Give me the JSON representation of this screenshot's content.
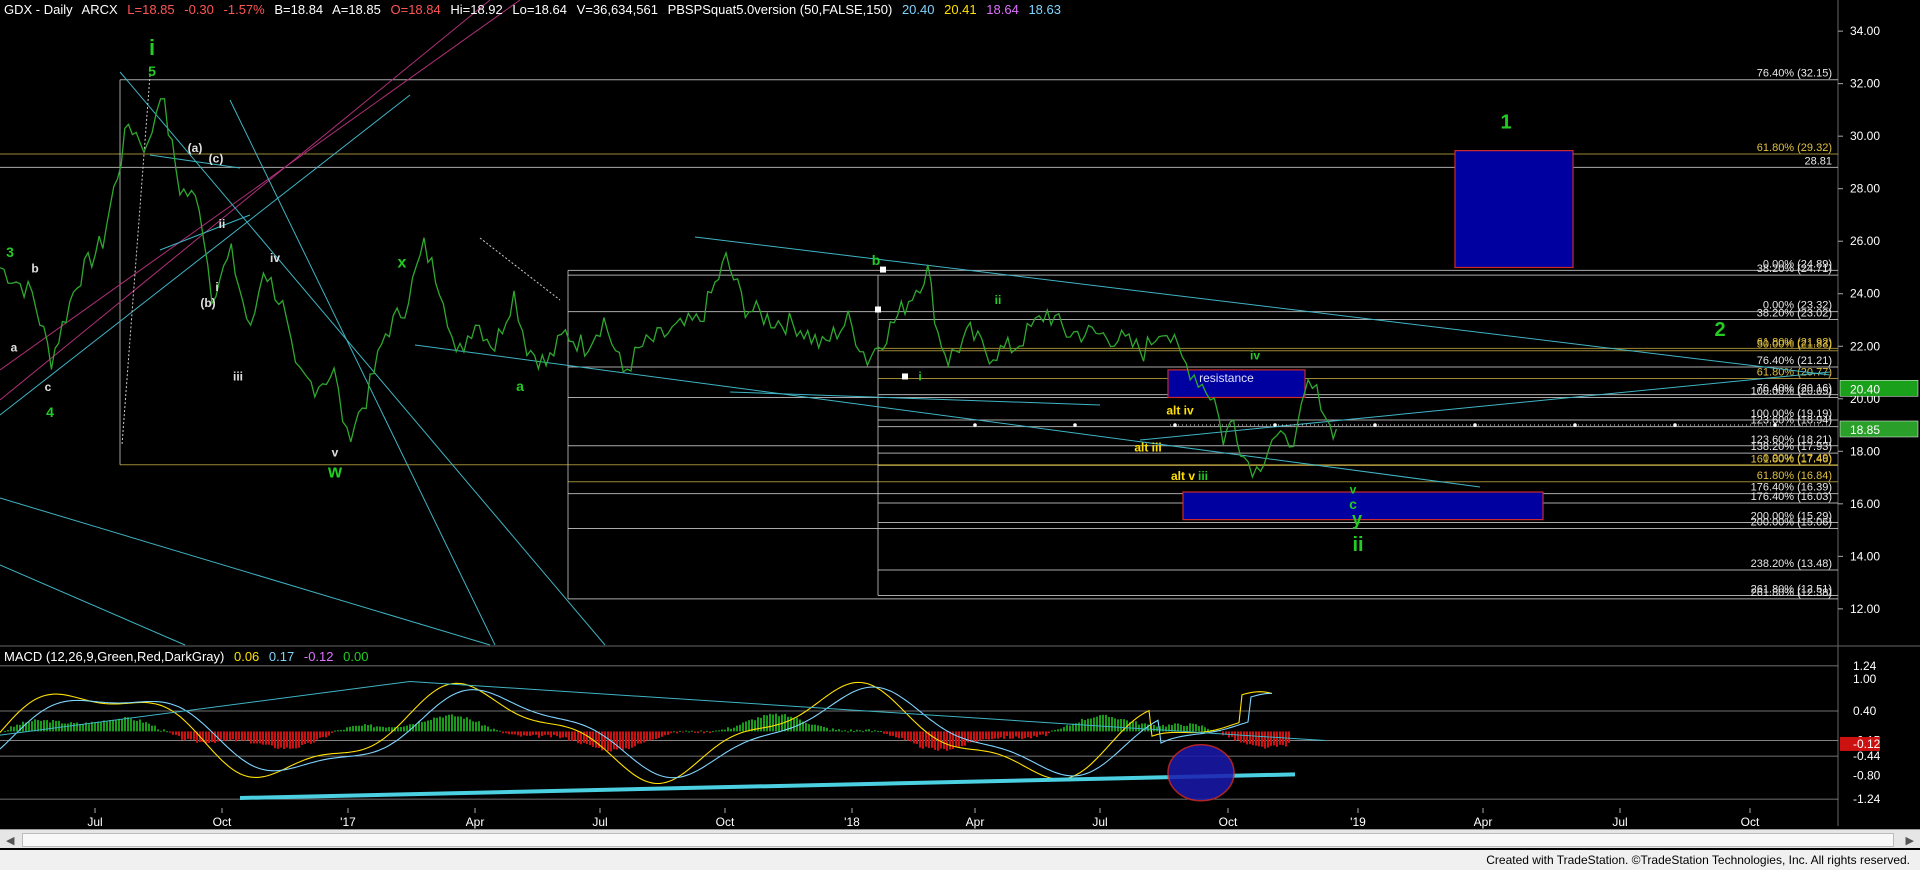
{
  "header": {
    "symbol": "GDX - Daily",
    "exchange": "ARCX",
    "last": "L=18.85",
    "change": "-0.30",
    "change_pct": "-1.57%",
    "bid": "B=18.84",
    "ask": "A=18.85",
    "open": "O=18.84",
    "high": "Hi=18.92",
    "low": "Lo=18.64",
    "volume": "V=36,634,561",
    "indicator": "PBSPSquat5.0version (50,FALSE,150)",
    "ind_v1": "20.40",
    "ind_v2": "20.41",
    "ind_v3": "18.64",
    "ind_v4": "18.63"
  },
  "macd_header": {
    "label": "MACD (12,26,9,Green,Red,DarkGray)",
    "v1": "0.06",
    "v2": "0.17",
    "v3": "-0.12",
    "v4": "0.00"
  },
  "footer": {
    "text": "Created with TradeStation. ©TradeStation Technologies, Inc. All rights reserved."
  },
  "colors": {
    "up": "#1a9a1a",
    "down": "#cc1111",
    "price": "#2ea82e",
    "wave_green": "#22cc22",
    "wave_white": "#e0e0e0",
    "wave_yellow": "#ffe000",
    "channel": "#3fb4c4",
    "magenta": "#b0307a",
    "box_fill": "#0000a0",
    "box_border": "#cc2a2a",
    "fib_line": "#c8c8c8"
  },
  "chart_data": {
    "type": "line",
    "title": "GDX - Daily ARCX",
    "price_axis": {
      "ylim": [
        11.5,
        34.5
      ],
      "ticks": [
        12,
        14,
        16,
        18,
        20,
        22,
        24,
        26,
        28,
        30,
        32,
        34
      ]
    },
    "x_ticks": [
      "Jul",
      "Oct",
      "'17",
      "Apr",
      "Jul",
      "Oct",
      "'18",
      "Apr",
      "Jul",
      "Oct",
      "'19",
      "Apr",
      "Jul",
      "Oct"
    ],
    "last_price_tags": [
      {
        "label": "20.40",
        "value": 20.4
      },
      {
        "label": "18.85",
        "value": 18.85
      }
    ],
    "price_series": [
      [
        0,
        25.0
      ],
      [
        25,
        24.0
      ],
      [
        40,
        21.5
      ],
      [
        60,
        24.5
      ],
      [
        80,
        26.0
      ],
      [
        100,
        30.5
      ],
      [
        115,
        29.5
      ],
      [
        125,
        31.8
      ],
      [
        140,
        28.0
      ],
      [
        155,
        27.5
      ],
      [
        165,
        24.0
      ],
      [
        180,
        25.5
      ],
      [
        195,
        22.5
      ],
      [
        205,
        25.0
      ],
      [
        220,
        23.5
      ],
      [
        230,
        21.0
      ],
      [
        245,
        20.5
      ],
      [
        260,
        21.0
      ],
      [
        270,
        18.5
      ],
      [
        285,
        20.0
      ],
      [
        300,
        22.5
      ],
      [
        315,
        23.5
      ],
      [
        330,
        25.8
      ],
      [
        345,
        24.0
      ],
      [
        355,
        21.5
      ],
      [
        370,
        23.0
      ],
      [
        385,
        22.0
      ],
      [
        400,
        24.0
      ],
      [
        410,
        22.0
      ],
      [
        425,
        21.3
      ],
      [
        440,
        22.5
      ],
      [
        455,
        22.0
      ],
      [
        470,
        23.0
      ],
      [
        485,
        21.0
      ],
      [
        500,
        22.0
      ],
      [
        520,
        22.5
      ],
      [
        545,
        23.0
      ],
      [
        565,
        25.3
      ],
      [
        580,
        23.5
      ],
      [
        600,
        23.0
      ],
      [
        620,
        22.8
      ],
      [
        640,
        22.0
      ],
      [
        660,
        23.0
      ],
      [
        675,
        21.5
      ],
      [
        690,
        22.5
      ],
      [
        710,
        24.0
      ],
      [
        722,
        24.9
      ],
      [
        730,
        22.5
      ],
      [
        738,
        21.5
      ],
      [
        755,
        22.5
      ],
      [
        770,
        21.7
      ],
      [
        790,
        22.0
      ],
      [
        815,
        23.3
      ],
      [
        830,
        22.5
      ],
      [
        850,
        22.5
      ],
      [
        870,
        22.3
      ],
      [
        890,
        21.8
      ],
      [
        905,
        22.8
      ],
      [
        920,
        21.5
      ],
      [
        945,
        20.0
      ],
      [
        952,
        18.5
      ],
      [
        960,
        19.2
      ],
      [
        968,
        17.8
      ],
      [
        978,
        17.3
      ],
      [
        990,
        18.5
      ],
      [
        1000,
        18.3
      ],
      [
        1010,
        18.8
      ],
      [
        1018,
        20.5
      ],
      [
        1028,
        20.0
      ],
      [
        1035,
        18.9
      ],
      [
        1040,
        18.85
      ]
    ],
    "fib_levels": [
      {
        "label": "76.40% (32.15)",
        "value": 32.15
      },
      {
        "label": "61.80% (29.32)",
        "value": 29.32
      },
      {
        "label": "28.81",
        "value": 28.81
      },
      {
        "label": "0.00% (24.89)",
        "value": 24.89
      },
      {
        "label": "38.20% (24.71)",
        "value": 24.71
      },
      {
        "label": "0.00% (23.32)",
        "value": 23.32
      },
      {
        "label": "38.20% (23.02)",
        "value": 23.02
      },
      {
        "label": "61.80% (21.92)",
        "value": 21.92
      },
      {
        "label": "50.00% (21.83)",
        "value": 21.83
      },
      {
        "label": "76.40% (21.21)",
        "value": 21.21
      },
      {
        "label": "61.80% (20.77)",
        "value": 20.77
      },
      {
        "label": "76.40% (20.16)",
        "value": 20.16
      },
      {
        "label": "100.00% (20.05)",
        "value": 20.05
      },
      {
        "label": "100.00% (19.19)",
        "value": 19.19
      },
      {
        "label": "123.60% (18.94)",
        "value": 18.94
      },
      {
        "label": "123.60% (18.21)",
        "value": 18.21
      },
      {
        "label": "138.20% (17.93)",
        "value": 17.93
      },
      {
        "label": "0.00% (17.49)",
        "value": 17.49
      },
      {
        "label": "161.80% (17.46)",
        "value": 17.46
      },
      {
        "label": "61.80% (16.84)",
        "value": 16.84
      },
      {
        "label": "176.40% (16.39)",
        "value": 16.39
      },
      {
        "label": "176.40% (16.03)",
        "value": 16.03
      },
      {
        "label": "200.00% (15.29)",
        "value": 15.29
      },
      {
        "label": "200.00% (15.06)",
        "value": 15.06
      },
      {
        "label": "238.20% (13.48)",
        "value": 13.48
      },
      {
        "label": "261.80% (12.51)",
        "value": 12.51
      },
      {
        "label": "261.80% (12.38)",
        "value": 12.38
      }
    ],
    "boxes": [
      {
        "label": "",
        "x1": 1455,
        "x2": 1573,
        "y1": 29.45,
        "y2": 25.0
      },
      {
        "label": "resistance",
        "x1": 1168,
        "x2": 1305,
        "y1": 21.1,
        "y2": 20.05
      },
      {
        "label": "",
        "x1": 1183,
        "x2": 1543,
        "y1": 16.45,
        "y2": 15.4
      }
    ],
    "wave_labels": [
      {
        "text": "i",
        "x": 152,
        "y": 33.1,
        "color": "wave_green",
        "size": 22
      },
      {
        "text": "5",
        "x": 152,
        "y": 32.3,
        "color": "wave_green",
        "size": 14
      },
      {
        "text": "3",
        "x": 10,
        "y": 25.4,
        "color": "wave_green",
        "size": 14
      },
      {
        "text": "b",
        "x": 35,
        "y": 24.8,
        "color": "wave_white",
        "size": 12
      },
      {
        "text": "a",
        "x": 14,
        "y": 21.8,
        "color": "wave_white",
        "size": 12
      },
      {
        "text": "c",
        "x": 48,
        "y": 20.3,
        "color": "wave_white",
        "size": 12
      },
      {
        "text": "4",
        "x": 50,
        "y": 19.3,
        "color": "wave_green",
        "size": 14
      },
      {
        "text": "(a)",
        "x": 195,
        "y": 29.4,
        "color": "wave_white",
        "size": 12
      },
      {
        "text": "(c)",
        "x": 216,
        "y": 29.0,
        "color": "wave_white",
        "size": 12
      },
      {
        "text": "ii",
        "x": 222,
        "y": 26.5,
        "color": "wave_white",
        "size": 12
      },
      {
        "text": "i",
        "x": 217,
        "y": 24.1,
        "color": "wave_white",
        "size": 12
      },
      {
        "text": "(b)",
        "x": 208,
        "y": 23.5,
        "color": "wave_white",
        "size": 12
      },
      {
        "text": "iv",
        "x": 275,
        "y": 25.2,
        "color": "wave_white",
        "size": 12
      },
      {
        "text": "iii",
        "x": 238,
        "y": 20.7,
        "color": "wave_white",
        "size": 12
      },
      {
        "text": "v",
        "x": 335,
        "y": 17.8,
        "color": "wave_white",
        "size": 12
      },
      {
        "text": "w",
        "x": 335,
        "y": 17.0,
        "color": "wave_green",
        "size": 18
      },
      {
        "text": "x",
        "x": 402,
        "y": 25.0,
        "color": "wave_green",
        "size": 16
      },
      {
        "text": "a",
        "x": 520,
        "y": 20.3,
        "color": "wave_green",
        "size": 14
      },
      {
        "text": "b",
        "x": 876,
        "y": 25.1,
        "color": "wave_green",
        "size": 14
      },
      {
        "text": "i",
        "x": 920,
        "y": 20.7,
        "color": "wave_green",
        "size": 12
      },
      {
        "text": "ii",
        "x": 998,
        "y": 23.6,
        "color": "wave_green",
        "size": 12
      },
      {
        "text": "iv",
        "x": 1255,
        "y": 21.5,
        "color": "wave_green",
        "size": 12
      },
      {
        "text": "alt iv",
        "x": 1180,
        "y": 19.4,
        "color": "wave_yellow",
        "size": 12
      },
      {
        "text": "alt iii",
        "x": 1148,
        "y": 18.0,
        "color": "wave_yellow",
        "size": 12
      },
      {
        "text": "alt v",
        "x": 1183,
        "y": 16.9,
        "color": "wave_yellow",
        "size": 12
      },
      {
        "text": "iii",
        "x": 1203,
        "y": 16.9,
        "color": "wave_green",
        "size": 12
      },
      {
        "text": "v",
        "x": 1353,
        "y": 16.4,
        "color": "wave_green",
        "size": 12
      },
      {
        "text": "c",
        "x": 1353,
        "y": 15.8,
        "color": "wave_green",
        "size": 14
      },
      {
        "text": "y",
        "x": 1357,
        "y": 15.2,
        "color": "wave_green",
        "size": 18
      },
      {
        "text": "ii",
        "x": 1358,
        "y": 14.2,
        "color": "wave_green",
        "size": 20
      },
      {
        "text": "1",
        "x": 1506,
        "y": 30.3,
        "color": "wave_green",
        "size": 20
      },
      {
        "text": "2",
        "x": 1720,
        "y": 22.4,
        "color": "wave_green",
        "size": 20
      }
    ],
    "macd": {
      "ylim": [
        -1.35,
        1.35
      ],
      "axis_labels": [
        "1.24",
        "1.00",
        "0.40",
        "-0.15",
        "-0.12",
        "-0.44",
        "-0.80",
        "-1.24"
      ],
      "reference_lines": [
        1.24,
        0.4,
        -0.15,
        -0.44,
        -1.24
      ]
    }
  }
}
